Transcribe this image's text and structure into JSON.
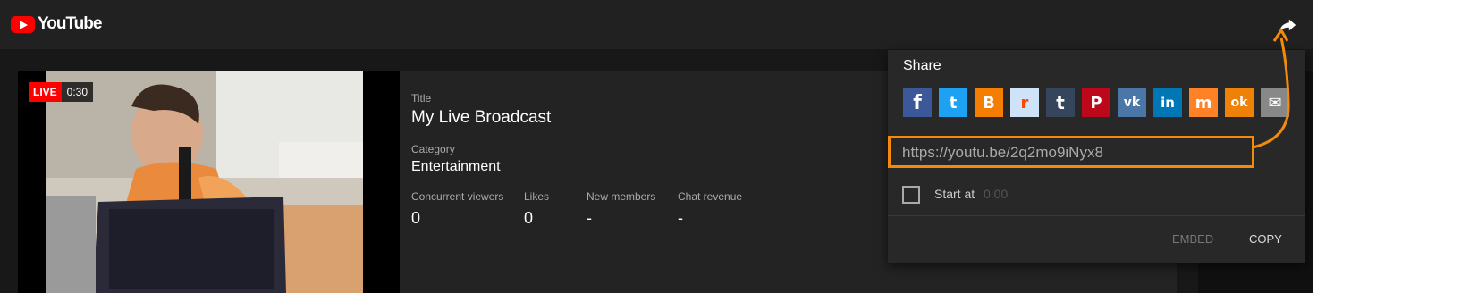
{
  "app": {
    "logo_text": "YouTube"
  },
  "topbar": {
    "share_icon": "share-arrow-icon"
  },
  "video": {
    "live_label": "LIVE",
    "elapsed": "0:30"
  },
  "broadcast": {
    "title_label": "Title",
    "title": "My Live Broadcast",
    "category_label": "Category",
    "category": "Entertainment",
    "stats": [
      {
        "label": "Concurrent viewers",
        "value": "0"
      },
      {
        "label": "Likes",
        "value": "0"
      },
      {
        "label": "New members",
        "value": "-"
      },
      {
        "label": "Chat revenue",
        "value": "-"
      }
    ]
  },
  "share": {
    "heading": "Share",
    "services": [
      {
        "name": "facebook",
        "color": "#3b5998",
        "glyph": "f"
      },
      {
        "name": "twitter",
        "color": "#1da1f2",
        "glyph": "t"
      },
      {
        "name": "blogger",
        "color": "#f57d00",
        "glyph": "B"
      },
      {
        "name": "reddit",
        "color": "#cee3f8",
        "glyph": "r"
      },
      {
        "name": "tumblr",
        "color": "#35465c",
        "glyph": "t"
      },
      {
        "name": "pinterest",
        "color": "#bd081c",
        "glyph": "P"
      },
      {
        "name": "vk",
        "color": "#4a76a8",
        "glyph": "vk"
      },
      {
        "name": "linkedin",
        "color": "#0077b5",
        "glyph": "in"
      },
      {
        "name": "mix",
        "color": "#ff8226",
        "glyph": "m"
      },
      {
        "name": "odnoklassniki",
        "color": "#ee8208",
        "glyph": "ok"
      },
      {
        "name": "email",
        "color": "#888888",
        "glyph": "✉"
      }
    ],
    "url": "https://youtu.be/2q2mo9iNyx8",
    "start_at_label": "Start at",
    "start_at_value": "0:00",
    "embed_label": "EMBED",
    "copy_label": "COPY"
  },
  "colors": {
    "highlight": "#f28b0c",
    "brand": "#ff0000",
    "background": "#181818"
  }
}
